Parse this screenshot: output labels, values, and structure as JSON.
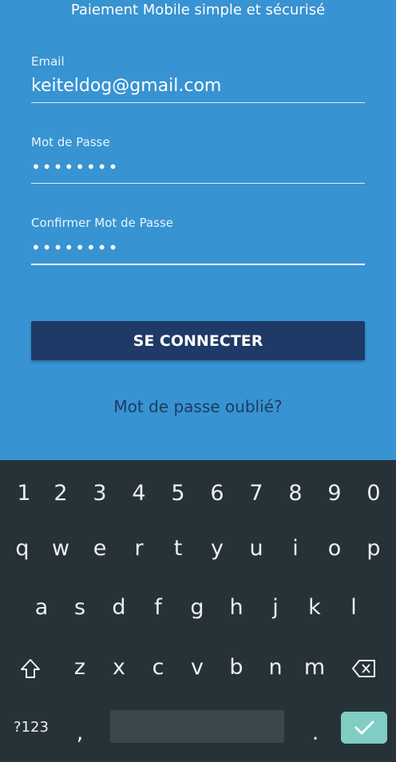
{
  "app": {
    "tagline": "Paiement Mobile simple et sécurisé",
    "fields": [
      {
        "label": "Email",
        "value": "keiteldog@gmail.com"
      },
      {
        "label": "Mot de Passe",
        "value": "••••••••"
      },
      {
        "label": "Confirmer Mot de Passe",
        "value": "••••••••"
      }
    ],
    "login_button": "SE CONNECTER",
    "forgot_link": "Mot de passe oublié?"
  },
  "keyboard": {
    "numbers": [
      "1",
      "2",
      "3",
      "4",
      "5",
      "6",
      "7",
      "8",
      "9",
      "0"
    ],
    "row1": [
      "q",
      "w",
      "e",
      "r",
      "t",
      "y",
      "u",
      "i",
      "o",
      "p"
    ],
    "row2": [
      "a",
      "s",
      "d",
      "f",
      "g",
      "h",
      "j",
      "k",
      "l"
    ],
    "row3": [
      "z",
      "x",
      "c",
      "v",
      "b",
      "n",
      "m"
    ],
    "symbols_key": "?123",
    "comma_key": ",",
    "period_key": ".",
    "colors": {
      "background": "#263238",
      "enter": "#7fcdc3",
      "space": "#3c474d"
    }
  },
  "colors": {
    "primary": "#3793d2",
    "button": "#1f3a66",
    "link": "#1d3b63"
  }
}
